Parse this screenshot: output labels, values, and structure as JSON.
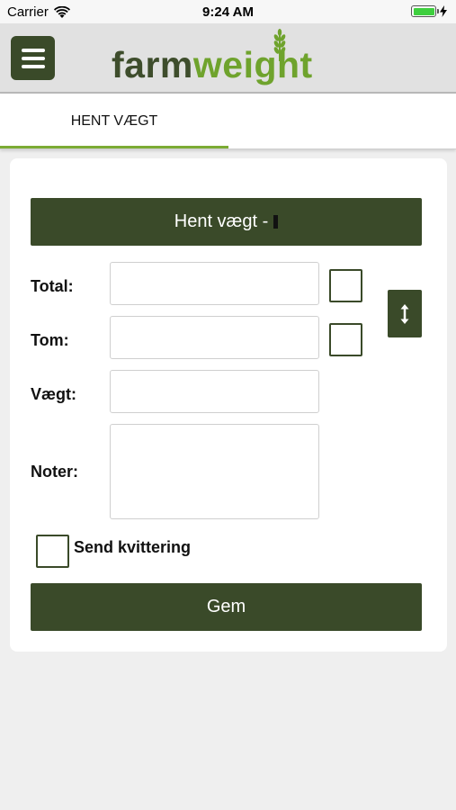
{
  "status_bar": {
    "carrier": "Carrier",
    "time": "9:24 AM",
    "battery_level": 1.0
  },
  "header": {
    "menu_icon": "hamburger-menu-icon",
    "logo_part1": "farm",
    "logo_part2": "weight",
    "logo_colors": {
      "farm": "#3e4d2c",
      "weight": "#6fa32d"
    }
  },
  "tabs": [
    {
      "label": "HENT VÆGT",
      "active": true
    }
  ],
  "form": {
    "fetch_button_label": "Hent vægt -",
    "labels": {
      "total": "Total:",
      "tom": "Tom:",
      "vaegt": "Vægt:",
      "noter": "Noter:"
    },
    "values": {
      "total": "",
      "tom": "",
      "vaegt": "",
      "noter": ""
    },
    "swap_icon": "vertical-arrows-icon",
    "send_receipt_label": "Send kvittering",
    "send_receipt_checked": false,
    "save_button_label": "Gem"
  },
  "colors": {
    "primary": "#3a4a29",
    "accent": "#7bab34",
    "background": "#efefef"
  }
}
